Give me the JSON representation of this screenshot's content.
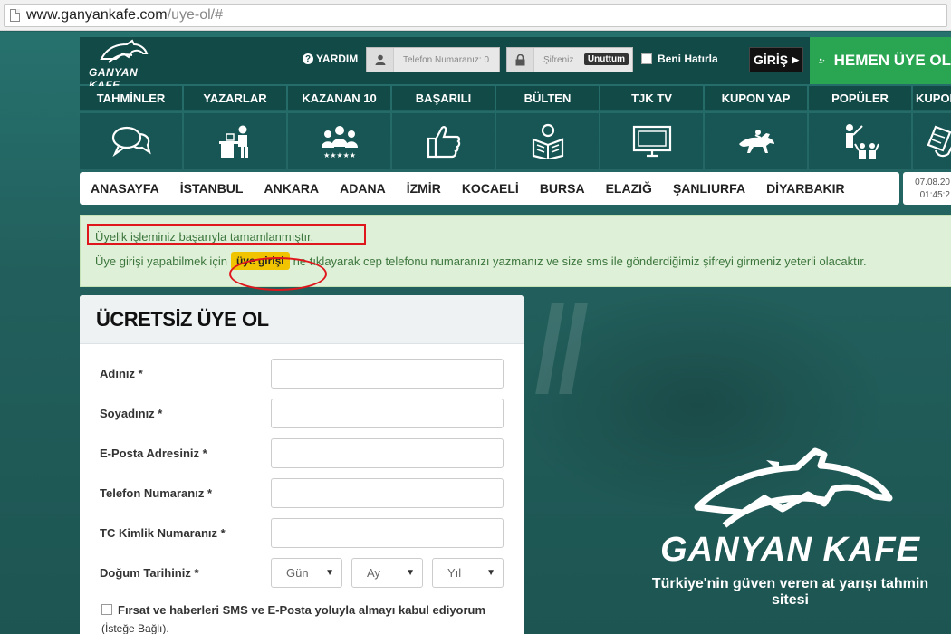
{
  "browser": {
    "url_host": "www.ganyankafe.com",
    "url_path": "/uye-ol/#"
  },
  "header": {
    "logo_text": "GANYAN KAFE",
    "help_label": "YARDIM",
    "phone_placeholder": "Telefon Numaranız: 0",
    "password_placeholder": "Şifreniz",
    "forgot_label": "Unuttum",
    "remember_label": "Beni Hatırla",
    "login_label": "GİRİŞ",
    "signup_label": "HEMEN ÜYE OL"
  },
  "categories": [
    {
      "label": "TAHMİNLER",
      "icon": "speech-bubbles-icon"
    },
    {
      "label": "YAZARLAR",
      "icon": "writer-desk-icon"
    },
    {
      "label": "KAZANAN 10",
      "icon": "winners-group-icon"
    },
    {
      "label": "BAŞARILI",
      "icon": "thumbs-up-icon"
    },
    {
      "label": "BÜLTEN",
      "icon": "reading-person-icon"
    },
    {
      "label": "TJK TV",
      "icon": "monitor-icon"
    },
    {
      "label": "KUPON YAP",
      "icon": "racing-horse-icon"
    },
    {
      "label": "POPÜLER",
      "icon": "audience-icon"
    },
    {
      "label": "KUPONLARI",
      "icon": "coupon-hand-icon"
    }
  ],
  "cities": [
    "ANASAYFA",
    "İSTANBUL",
    "ANKARA",
    "ADANA",
    "İZMİR",
    "KOCAELİ",
    "BURSA",
    "ELAZIĞ",
    "ŞANLIURFA",
    "DİYARBAKIR"
  ],
  "datetime": {
    "date": "07.08.20",
    "time": "01:45:2"
  },
  "alert": {
    "line1": "Üyelik işleminiz başarıyla tamamlanmıştır.",
    "line2_pre": "Üye girişi yapabilmek için",
    "button": "üye girişi",
    "line2_post": "ne tıklayarak cep telefonu numaranızı yazmanız ve size sms ile gönderdiğimiz şifreyi girmeniz yeterli olacaktır."
  },
  "form": {
    "title": "ÜCRETSİZ ÜYE OL",
    "fields": [
      {
        "label": "Adınız *",
        "value": ""
      },
      {
        "label": "Soyadınız *",
        "value": ""
      },
      {
        "label": "E-Posta Adresiniz *",
        "value": ""
      },
      {
        "label": "Telefon Numaranız *",
        "value": ""
      },
      {
        "label": "TC Kimlik Numaranız *",
        "value": ""
      }
    ],
    "birth_label": "Doğum Tarihiniz *",
    "day_label": "Gün",
    "month_label": "Ay",
    "year_label": "Yıl",
    "consent_text": "Fırsat ve haberleri SMS ve E-Posta yoluyla almayı kabul ediyorum",
    "consent_optional": "(İsteğe Bağlı)."
  },
  "brand": {
    "name": "GANYAN KAFE",
    "tagline": "Türkiye'nin güven veren at yarışı tahmin sitesi"
  },
  "colors": {
    "brand_dark": "#124a48",
    "signup_green": "#2aa552",
    "alert_bg": "#dff0d8",
    "alert_text": "#3c763d",
    "highlight_red": "#e0161d",
    "button_yellow": "#f0c400"
  }
}
